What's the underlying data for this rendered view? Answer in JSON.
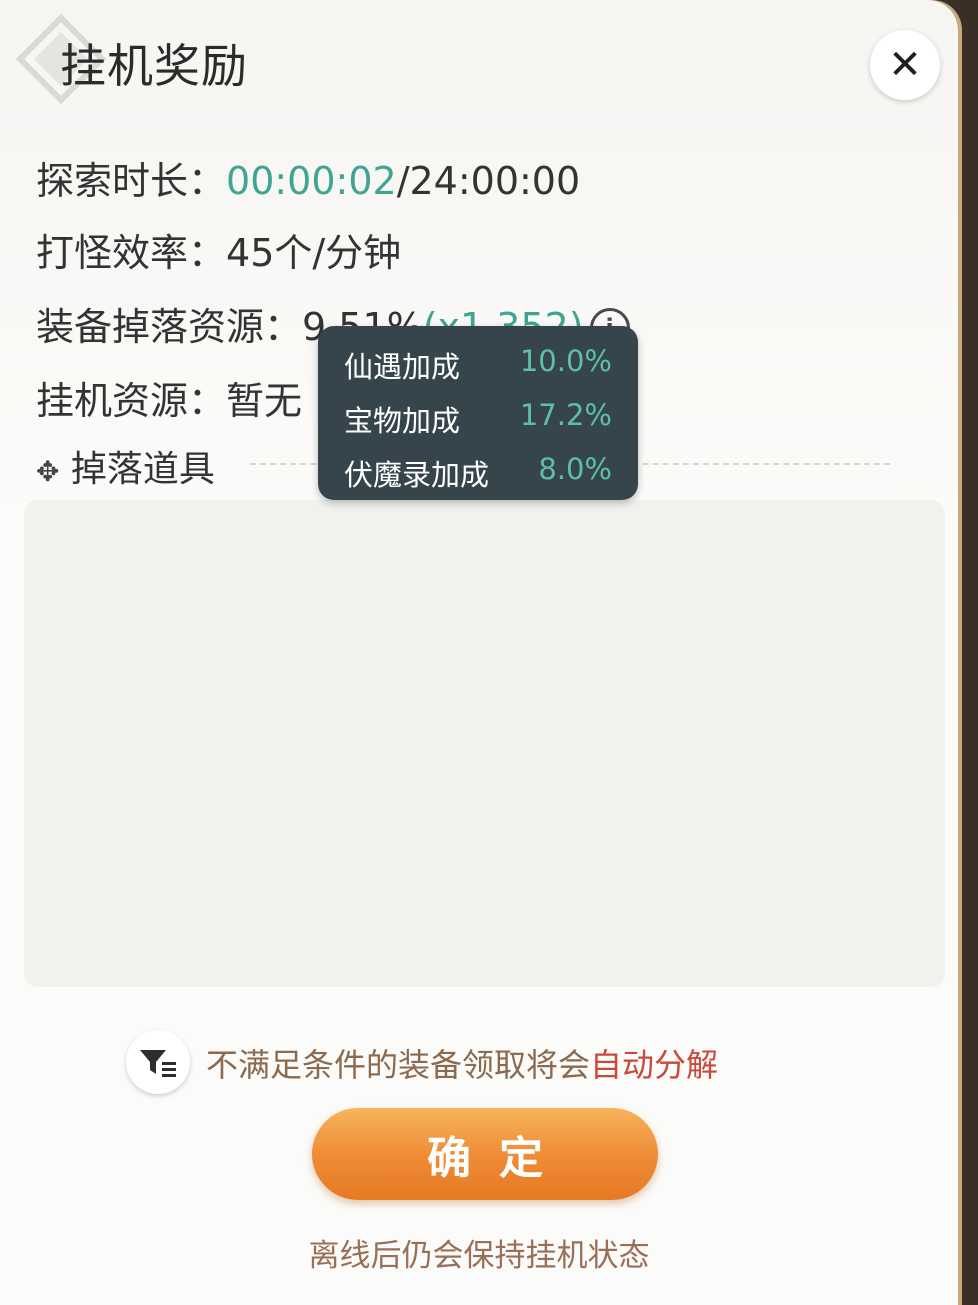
{
  "dialog": {
    "title": "挂机奖励",
    "close_icon": "close-icon"
  },
  "stats": {
    "explore_label": "探索时长：",
    "explore_elapsed": "00:00:02",
    "explore_total": "/24:00:00",
    "efficiency_label": "打怪效率：",
    "efficiency_value": "45个/分钟",
    "equip_label": "装备掉落资源：",
    "equip_value": "9.51%",
    "equip_multiplier": "(x1.352)",
    "idle_label": "挂机资源：",
    "idle_value": "暂无"
  },
  "tooltip": {
    "rows": [
      {
        "label": "仙遇加成",
        "value": "10.0%"
      },
      {
        "label": "宝物加成",
        "value": "17.2%"
      },
      {
        "label": "伏魔录加成",
        "value": "8.0%"
      }
    ]
  },
  "drops": {
    "label": "掉落道具"
  },
  "notice": {
    "text": "不满足条件的装备领取将会",
    "highlight": "自动分解"
  },
  "confirm_button": "确定",
  "offline_note": "离线后仍会保持挂机状态",
  "colors": {
    "accent_green": "#3fa592",
    "button_orange": "#ee8a33",
    "highlight_red": "#c94a3a",
    "tooltip_bg": "#36454b"
  }
}
